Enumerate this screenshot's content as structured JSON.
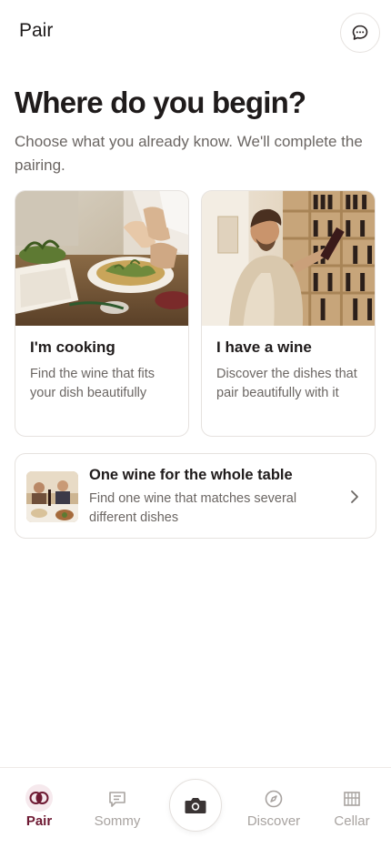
{
  "header": {
    "title": "Pair",
    "chat_icon": "chat-bubble-icon"
  },
  "main": {
    "headline": "Where do you begin?",
    "subheadline": "Choose what you already know. We'll complete the pairing.",
    "cards": [
      {
        "title": "I'm cooking",
        "description": "Find the wine that fits your dish beautifully",
        "image": "cooking-photo"
      },
      {
        "title": "I have a wine",
        "description": "Discover the dishes that pair beautifully with it",
        "image": "wine-shop-photo"
      }
    ],
    "table_option": {
      "title": "One wine for the whole table",
      "description": "Find one wine that matches several different dishes",
      "image": "dinner-table-photo",
      "chevron_icon": "chevron-right-icon"
    }
  },
  "bottom_nav": {
    "items": [
      {
        "label": "Pair",
        "icon": "pair-rings-icon",
        "active": true
      },
      {
        "label": "Sommy",
        "icon": "chat-note-icon",
        "active": false
      },
      {
        "label": "",
        "icon": "camera-icon",
        "active": false
      },
      {
        "label": "Discover",
        "icon": "compass-icon",
        "active": false
      },
      {
        "label": "Cellar",
        "icon": "cellar-rack-icon",
        "active": false
      }
    ]
  },
  "colors": {
    "accent": "#6e1a33",
    "text_primary": "#1f1b1b",
    "text_secondary": "#6b6663",
    "nav_inactive": "#a8a3a0",
    "border": "#e6e2df"
  }
}
